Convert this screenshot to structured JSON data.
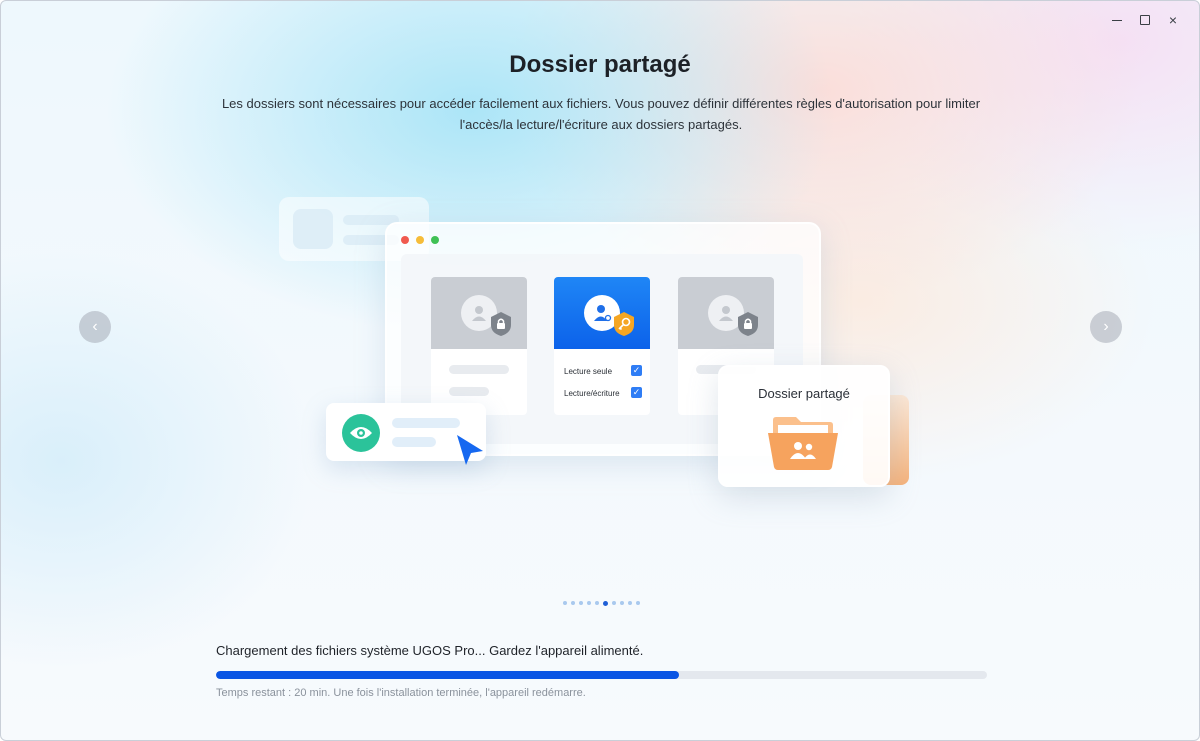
{
  "window": {
    "controls": {
      "minimize": "minimize-icon",
      "maximize": "maximize-icon",
      "close": "×"
    }
  },
  "header": {
    "title": "Dossier partagé",
    "description": "Les dossiers sont nécessaires pour accéder facilement aux fichiers. Vous pouvez définir différentes règles d'autorisation pour limiter l'accès/la lecture/l'écriture aux dossiers partagés."
  },
  "carousel": {
    "prev_icon": "‹",
    "next_icon": "›",
    "slide_count": 10,
    "active_index": 5
  },
  "illustration": {
    "permissions": {
      "read_only": "Lecture seule",
      "read_write": "Lecture/écriture"
    },
    "shared_folder_label": "Dossier partagé",
    "colors": {
      "accent_blue": "#0c62ea",
      "eye_green": "#2bc39a",
      "lock_grey": "#7d838b",
      "key_orange": "#f5a623",
      "folder_orange": "#f6a35e"
    }
  },
  "progress": {
    "status_text": "Chargement des fichiers système UGOS Pro... Gardez l'appareil alimenté.",
    "percent": 60,
    "note": "Temps restant : 20 min. Une fois l'installation terminée, l'appareil redémarre.",
    "bar_color": "#0a55e4"
  }
}
